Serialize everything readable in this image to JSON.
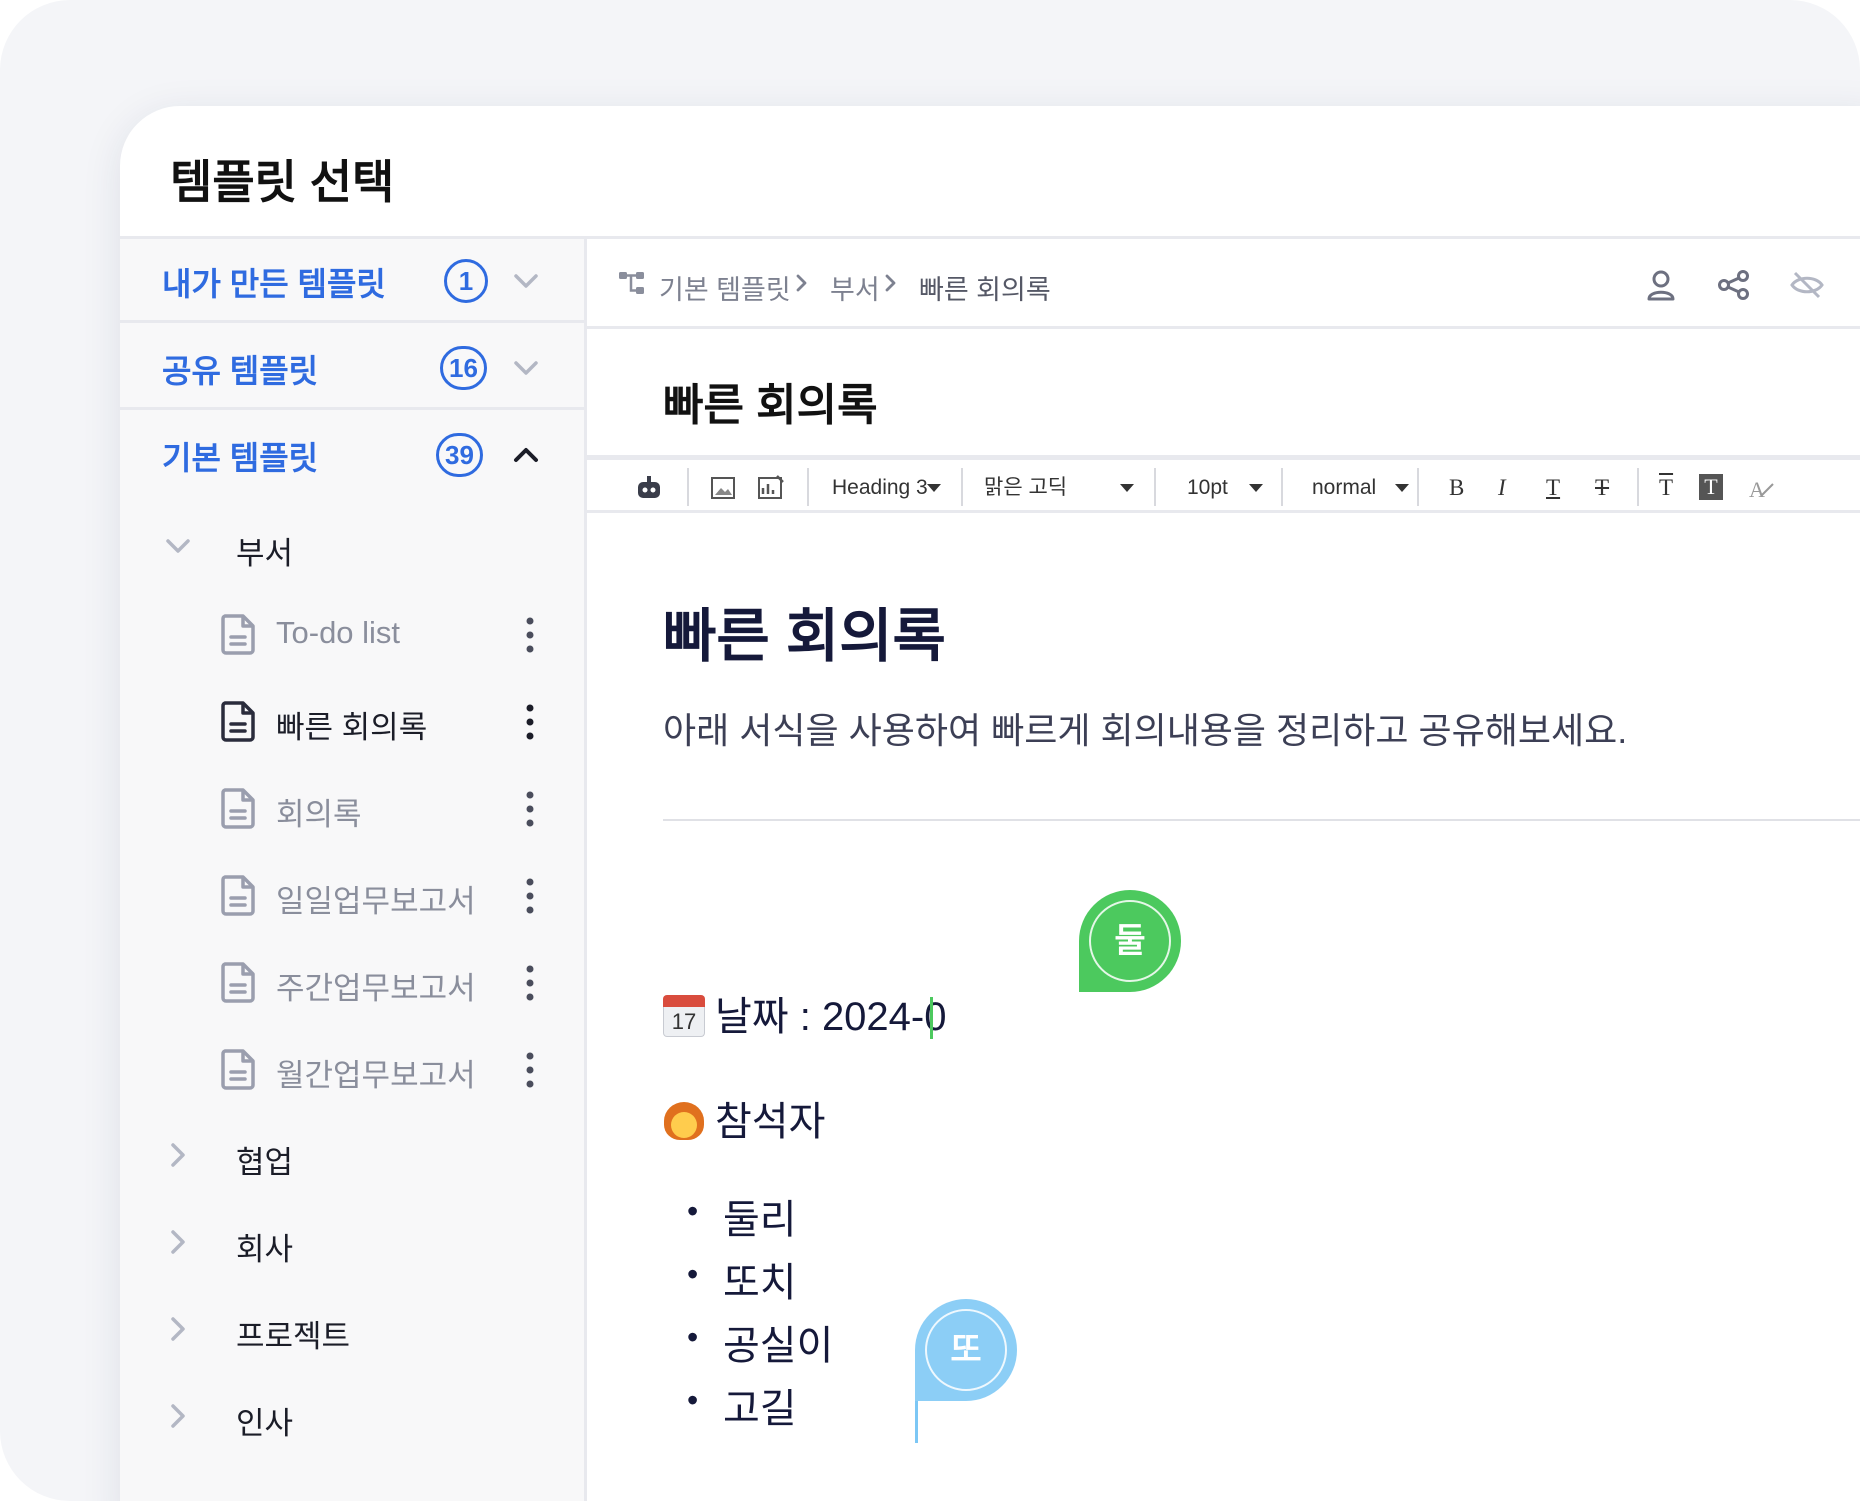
{
  "window": {
    "title": "템플릿 선택"
  },
  "sidebar": {
    "sections": [
      {
        "label": "내가 만든 템플릿",
        "count": "1",
        "expanded": false
      },
      {
        "label": "공유 템플릿",
        "count": "16",
        "expanded": false
      },
      {
        "label": "기본 템플릿",
        "count": "39",
        "expanded": true
      }
    ],
    "folders": [
      {
        "label": "부서",
        "expanded": true
      },
      {
        "label": "협업",
        "expanded": false
      },
      {
        "label": "회사",
        "expanded": false
      },
      {
        "label": "프로젝트",
        "expanded": false
      },
      {
        "label": "인사",
        "expanded": false
      }
    ],
    "templates": [
      {
        "label": "To-do list",
        "active": false
      },
      {
        "label": "빠른 회의록",
        "active": true
      },
      {
        "label": "회의록",
        "active": false
      },
      {
        "label": "일일업무보고서",
        "active": false
      },
      {
        "label": "주간업무보고서",
        "active": false
      },
      {
        "label": "월간업무보고서",
        "active": false
      }
    ]
  },
  "breadcrumb": {
    "items": [
      "기본 템플릿",
      "부서",
      "빠른 회의록"
    ]
  },
  "document": {
    "title": "빠른 회의록"
  },
  "toolbar": {
    "heading": "Heading 3",
    "font": "맑은 고딕",
    "size": "10pt",
    "spacing": "normal",
    "bold": "B",
    "italic": "I",
    "underline": "T",
    "strike": "T",
    "text_color": "T",
    "highlight": "T"
  },
  "editor": {
    "title": "빠른 회의록",
    "description": "아래 서식을 사용하여 빠르게 회의내용을 정리하고 공유해보세요.",
    "date_icon_label": "17",
    "date_line": "날짜 : 2024-0",
    "attendees_heading": "참석자",
    "attendees": [
      "둘리",
      "또치",
      "공실이",
      "고길"
    ]
  },
  "collaborators": [
    {
      "initial": "둘",
      "color": "#4cc95e"
    },
    {
      "initial": "또",
      "color": "#7cc7f5"
    }
  ],
  "colors": {
    "accent": "#2f6be0",
    "text_dark": "#15193a",
    "muted": "#8a8e9c"
  }
}
